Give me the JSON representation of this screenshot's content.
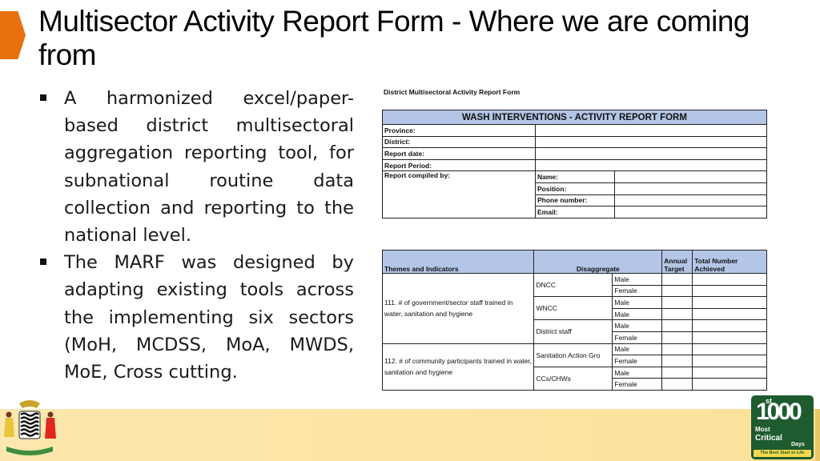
{
  "slide": {
    "title": "Multisector Activity Report Form - Where we are coming from",
    "accent_color": "#E8700F",
    "bullets": [
      "A harmonized excel/paper-based district multisectoral aggregation reporting tool, for subnational routine data collection and reporting to the national level.",
      "The MARF was designed by adapting existing tools across the implementing six sectors (MoH, MCDSS, MoA, MWDS, MoE, Cross cutting."
    ]
  },
  "form": {
    "caption": "District Multisectoral Activity Report Form",
    "header_color": "#B4C6E7",
    "info_table": {
      "title": "WASH INTERVENTIONS - ACTIVITY REPORT FORM",
      "fields": [
        "Province:",
        "District:",
        "Report date:",
        "Report Period:"
      ],
      "compiled_by_label": "Report compiled by:",
      "compiled_by_fields": [
        "Name:",
        "Position:",
        "Phone number:",
        "Email:"
      ]
    },
    "indicator_table": {
      "headers": {
        "themes": "Themes and Indicators",
        "disaggregate": "Disaggregate",
        "annual_target": "Annual Target",
        "total_achieved": "Total Number Achieved"
      },
      "indicators": [
        {
          "label": "111. # of government/sector staff trained in water, sanitation and hygiene",
          "groups": [
            {
              "name": "DNCC",
              "rows": [
                "Male",
                "Female"
              ]
            },
            {
              "name": "WNCC",
              "rows": [
                "Male",
                "Male"
              ]
            },
            {
              "name": "District staff",
              "rows": [
                "Male",
                "Female"
              ]
            }
          ]
        },
        {
          "label": "112. # of community participants  trained in water, sanitation and hygiene",
          "groups": [
            {
              "name": "Sanitation Action Gro",
              "rows": [
                "Male",
                "Female"
              ]
            },
            {
              "name": "CCs/CHWs",
              "rows": [
                "Male",
                "Female"
              ]
            }
          ]
        }
      ]
    }
  },
  "footer": {
    "band_color": "#FBE19A",
    "left_logo": "zambia-coat-of-arms",
    "right_logo": {
      "number": "1000",
      "superscript": "st",
      "line1": "Most",
      "line2": "Critical",
      "line3": "Days",
      "tagline": "The Best Start to Life",
      "color": "#1E5B2E"
    }
  }
}
